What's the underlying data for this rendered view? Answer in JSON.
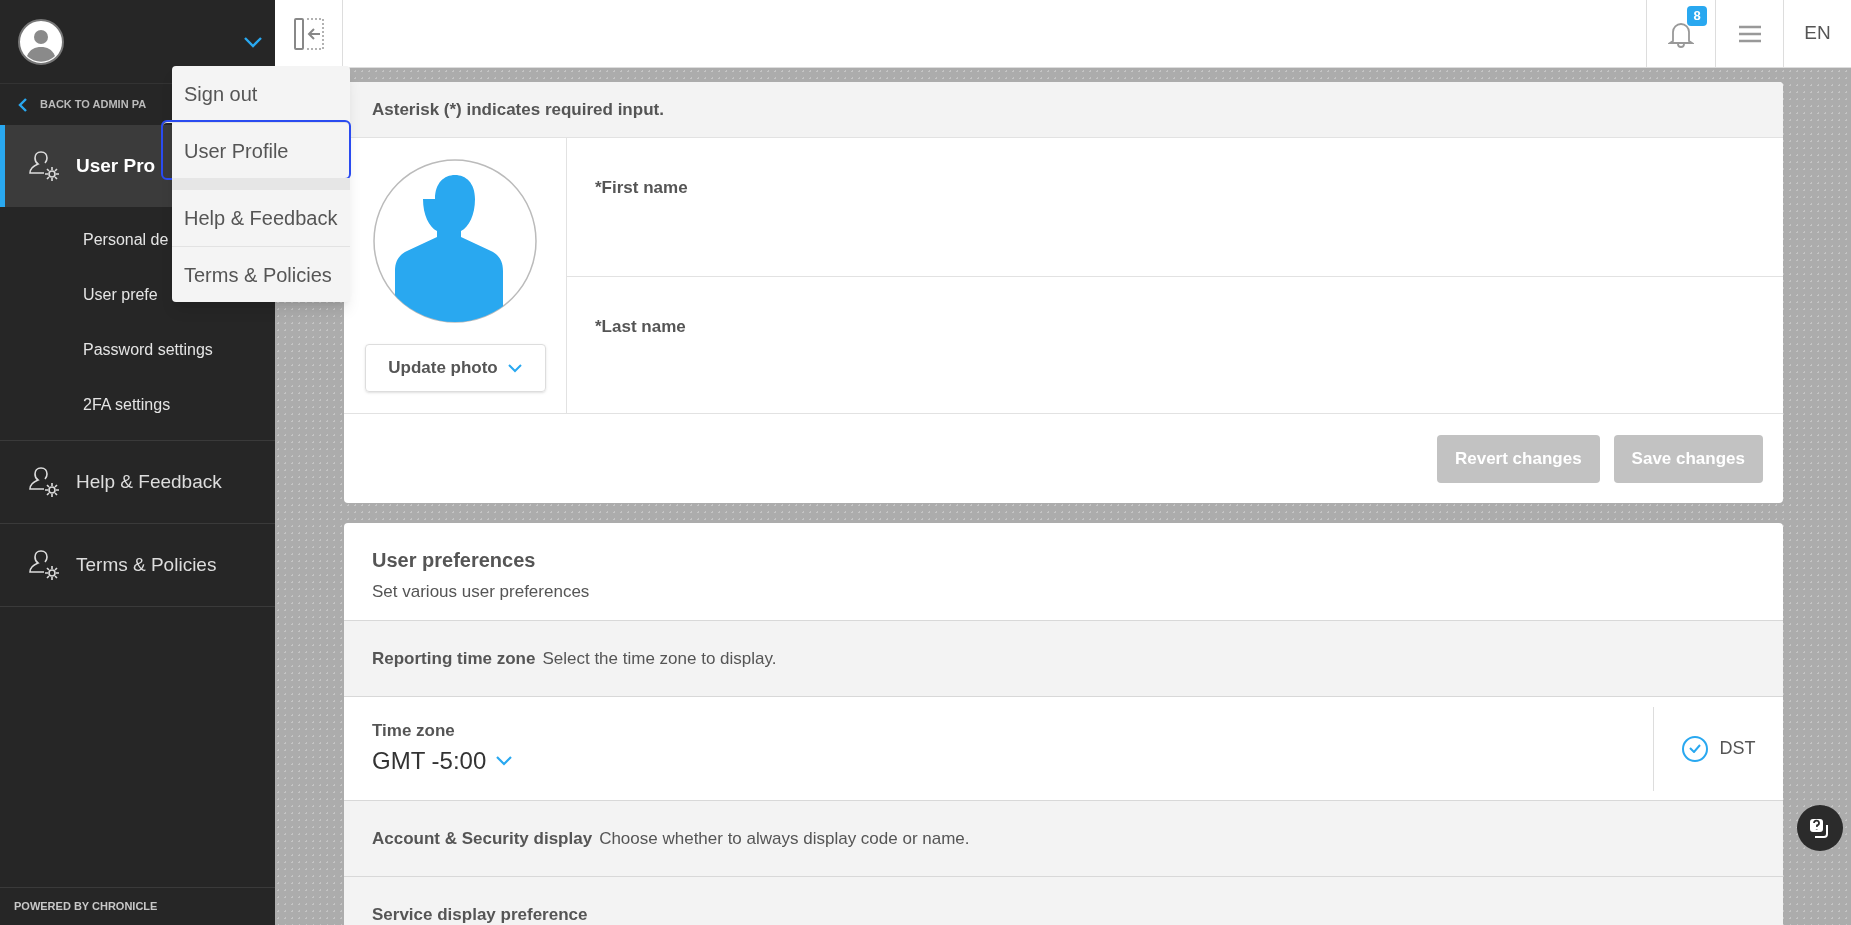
{
  "sidebar": {
    "back_link": "BACK TO ADMIN PA",
    "sections": [
      {
        "label": "User Pro",
        "selected": true,
        "expanded": true,
        "children": [
          {
            "label": "Personal de"
          },
          {
            "label": "User prefe"
          },
          {
            "label": "Password settings"
          },
          {
            "label": "2FA settings"
          }
        ]
      },
      {
        "label": "Help & Feedback",
        "selected": false,
        "expanded": false
      },
      {
        "label": "Terms & Policies",
        "selected": false,
        "expanded": false
      }
    ],
    "footer": "POWERED BY CHRONICLE"
  },
  "user_menu": {
    "groups": [
      {
        "items": [
          {
            "label": "Sign out",
            "selected": false
          },
          {
            "label": "User Profile",
            "selected": true
          }
        ]
      },
      {
        "items": [
          {
            "label": "Help & Feedback",
            "selected": false
          },
          {
            "label": "Terms & Policies",
            "selected": false
          }
        ]
      }
    ]
  },
  "header": {
    "notification_count": "8",
    "language": "EN"
  },
  "profile_card": {
    "note": "Asterisk (*) indicates required input.",
    "photo_button": "Update photo",
    "fields": [
      {
        "label": "*First name"
      },
      {
        "label": "*Last name"
      }
    ],
    "buttons": [
      {
        "label": "Revert changes",
        "disabled": true
      },
      {
        "label": "Save changes",
        "disabled": true
      }
    ]
  },
  "preferences": {
    "title": "User preferences",
    "subtitle": "Set various user preferences",
    "rows": [
      {
        "kind": "heading",
        "title": "Reporting time zone",
        "description": "Select the time zone to display."
      },
      {
        "kind": "select",
        "label": "Time zone",
        "value": "GMT -5:00",
        "option": {
          "label": "DST",
          "checked": true
        }
      },
      {
        "kind": "heading",
        "title": "Account & Security display",
        "description": "Choose whether to always display code or name."
      },
      {
        "kind": "heading",
        "title": "Service display preference"
      }
    ]
  }
}
